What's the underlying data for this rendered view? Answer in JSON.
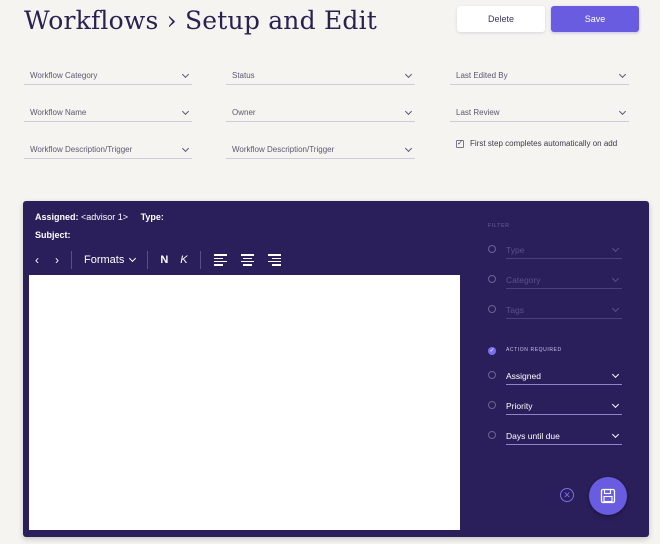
{
  "header": {
    "title": "Workflows › Setup and Edit",
    "delete_label": "Delete",
    "save_label": "Save"
  },
  "filters": {
    "workflow_category": "Workflow Category",
    "status": "Status",
    "last_edited_by": "Last Edited By",
    "workflow_name": "Workflow Name",
    "owner": "Owner",
    "last_review": "Last Review",
    "workflow_description_1": "Workflow Description/Trigger",
    "workflow_description_2": "Workflow Description/Trigger",
    "auto_complete_label": "First step completes automatically on add",
    "auto_complete_checked": true
  },
  "step": {
    "assigned_label": "Assigned:",
    "assigned_value": "<advisor 1>",
    "type_label": "Type:",
    "subject_label": "Subject:"
  },
  "toolbar": {
    "back_icon": "‹",
    "forward_icon": "›",
    "formats_label": "Formats",
    "bold_label": "N",
    "italic_label": "K"
  },
  "sidebar": {
    "header": "FILTER",
    "type": "Type",
    "category": "Category",
    "tags": "Tags",
    "action_required": "ACTION REQUIRED",
    "assigned": "Assigned",
    "priority": "Priority",
    "days_until_due": "Days until due"
  },
  "colors": {
    "panel_bg": "#2a1f5a",
    "accent": "#6a5ce0",
    "page_bg": "#f6f4f1"
  }
}
